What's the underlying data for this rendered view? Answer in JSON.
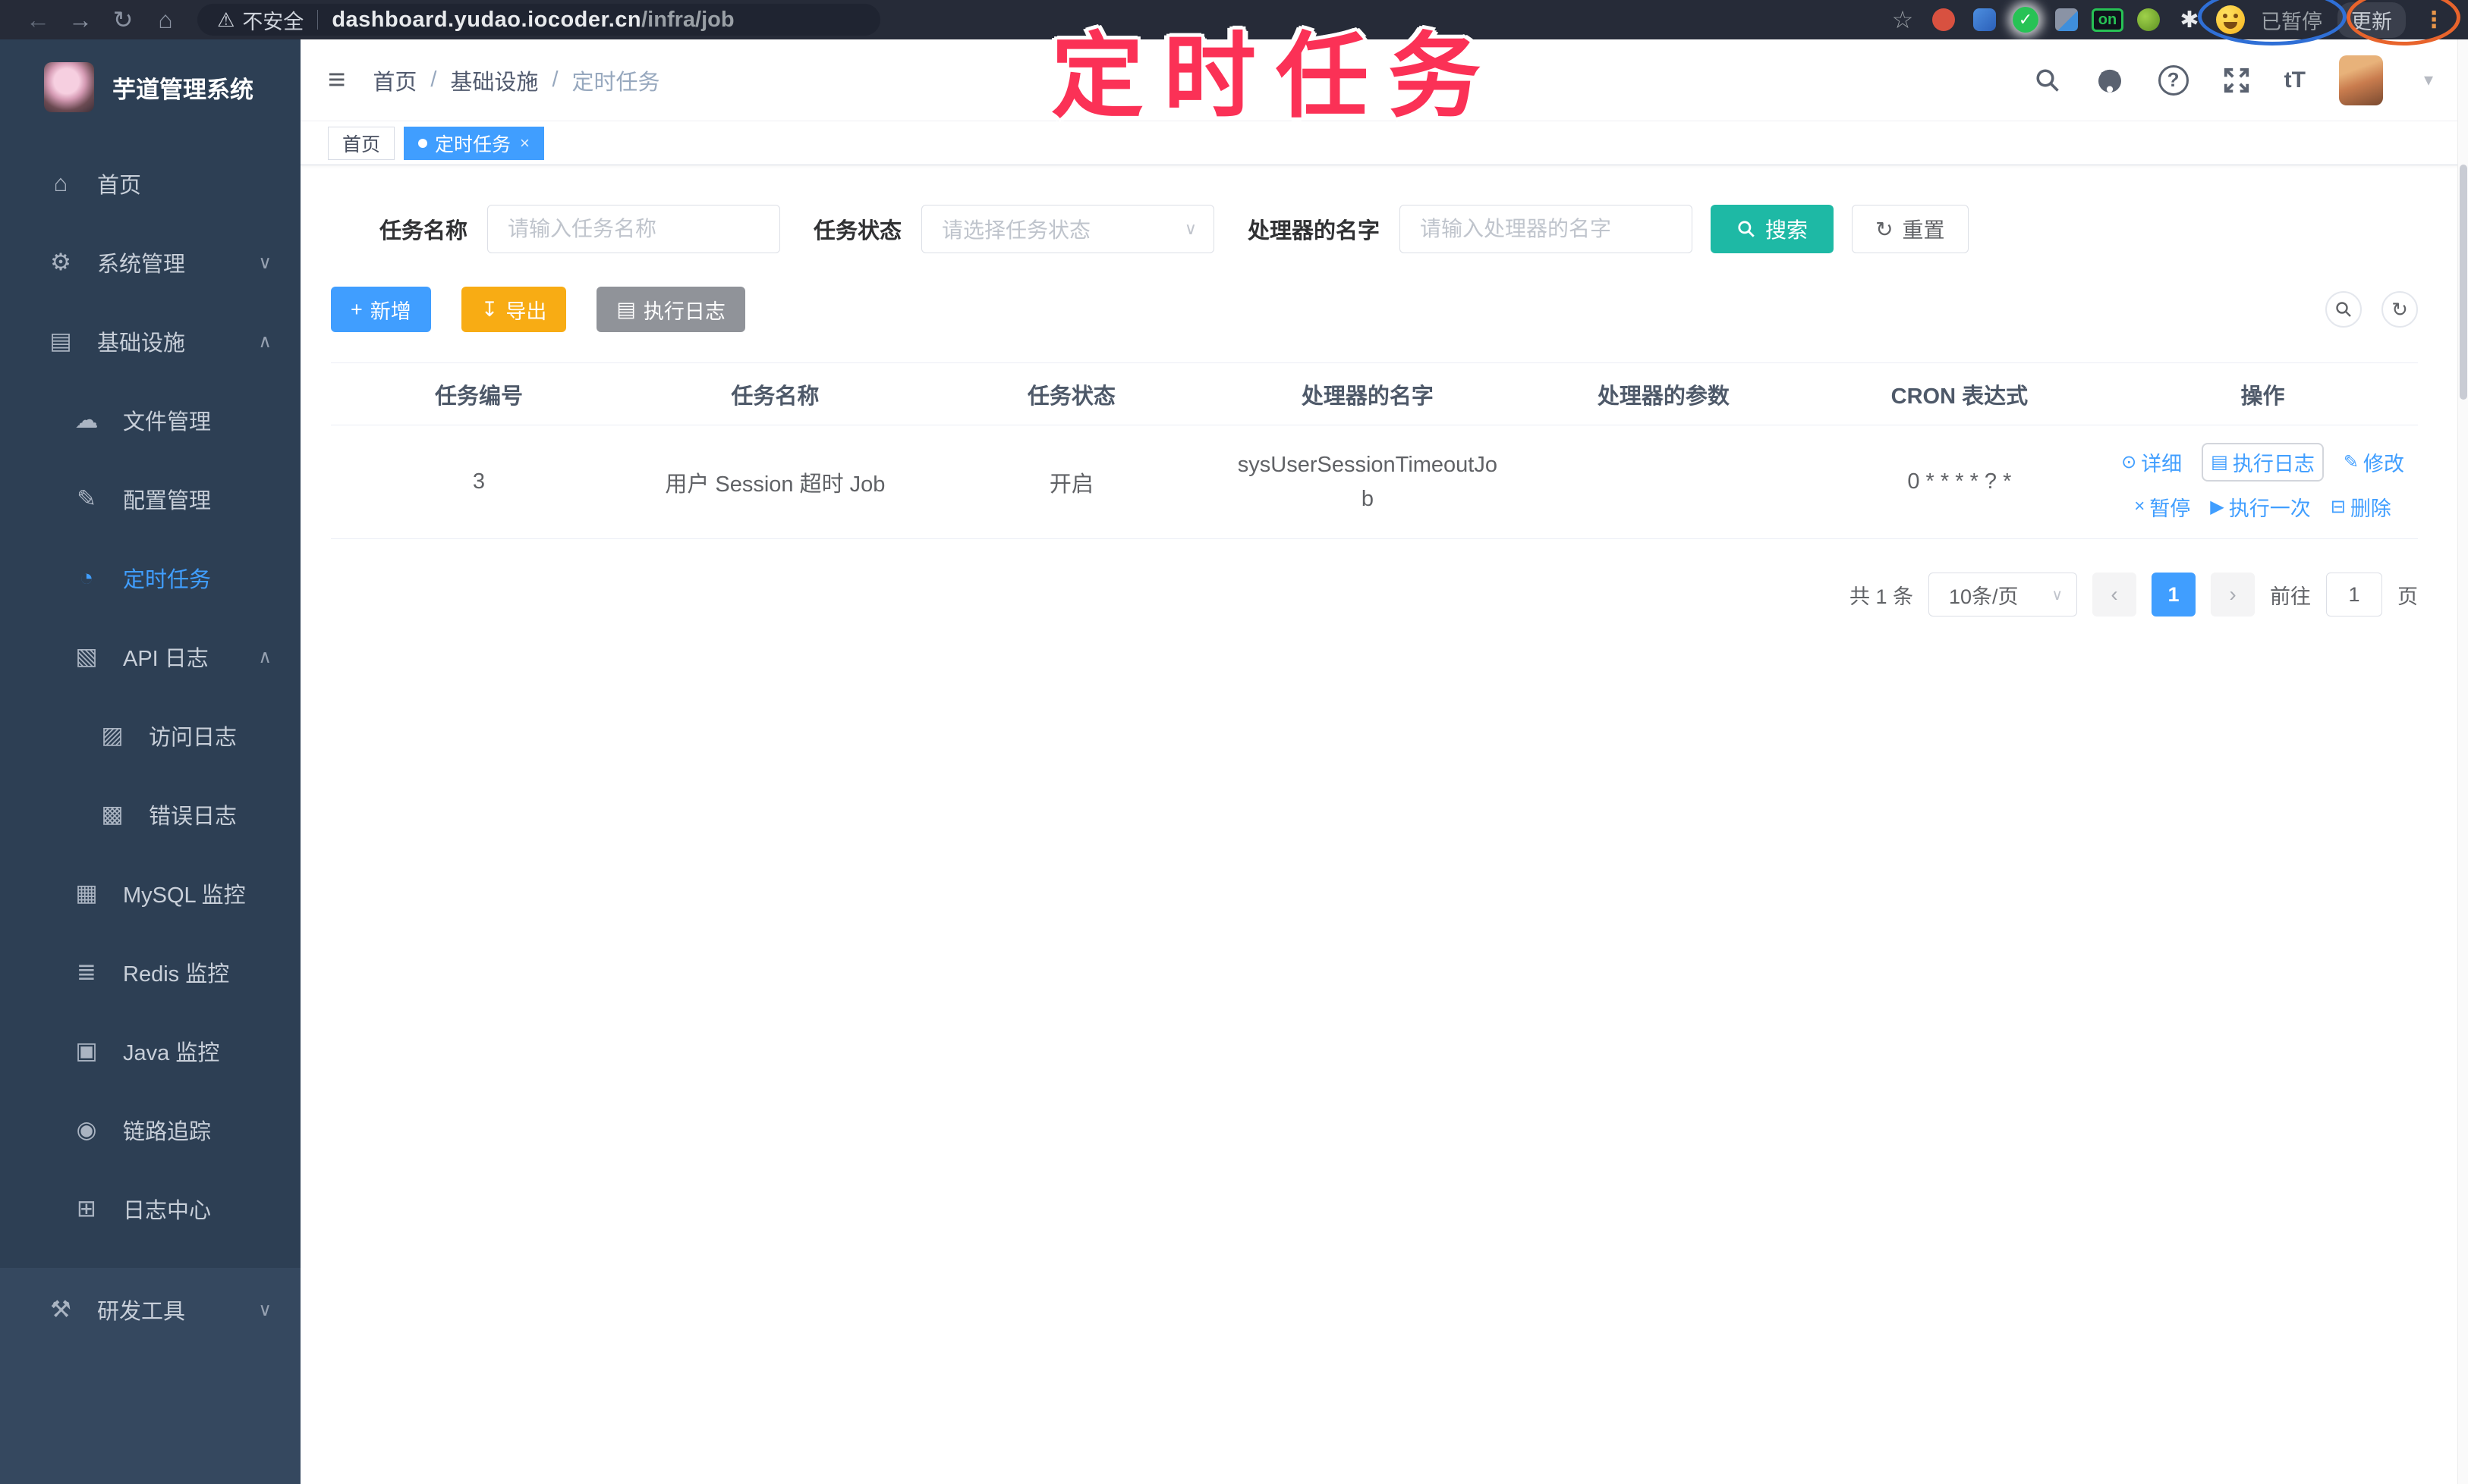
{
  "browser": {
    "security_label": "不安全",
    "url_domain": "dashboard.yudao.iocoder.cn",
    "url_path": "/infra/job",
    "paused_label": "已暂停",
    "update_label": "更新",
    "kebab_glyph": "⋮",
    "back_glyph": "←",
    "forward_glyph": "→",
    "reload_glyph": "↻",
    "home_glyph": "⌂",
    "warning_glyph": "⚠",
    "star_glyph": "☆",
    "puzzle_glyph": "✱",
    "check_glyph": "✓",
    "on_label": "on"
  },
  "annotation": {
    "title": "定时任务",
    "title_color": "#fb3156",
    "ellipse_blue_color": "#2f6fd6",
    "ellipse_orange_color": "#e8642c"
  },
  "sidebar": {
    "app_title": "芋道管理系统",
    "items": [
      {
        "label": "首页",
        "icon_glyph": "⌂"
      },
      {
        "label": "系统管理",
        "icon_glyph": "⚙",
        "chevron": "∨"
      },
      {
        "label": "基础设施",
        "icon_glyph": "▤",
        "chevron": "∧"
      },
      {
        "label": "文件管理",
        "icon_glyph": "☁"
      },
      {
        "label": "配置管理",
        "icon_glyph": "✎"
      },
      {
        "label": "定时任务",
        "icon_glyph": "◔"
      },
      {
        "label": "API 日志",
        "icon_glyph": "▧",
        "chevron": "∧"
      },
      {
        "label": "访问日志",
        "icon_glyph": "▨"
      },
      {
        "label": "错误日志",
        "icon_glyph": "▩"
      },
      {
        "label": "MySQL 监控",
        "icon_glyph": "▦"
      },
      {
        "label": "Redis 监控",
        "icon_glyph": "≣"
      },
      {
        "label": "Java 监控",
        "icon_glyph": "▣"
      },
      {
        "label": "链路追踪",
        "icon_glyph": "◉"
      },
      {
        "label": "日志中心",
        "icon_glyph": "⊞"
      },
      {
        "label": "研发工具",
        "icon_glyph": "⚒",
        "chevron": "∨"
      }
    ]
  },
  "header": {
    "hamburger_glyph": "≡",
    "breadcrumb": [
      "首页",
      "基础设施",
      "定时任务"
    ],
    "separator": "/",
    "help_glyph": "?",
    "fontsize_glyph": "tT",
    "caret_glyph": "▾"
  },
  "tabs": [
    {
      "label": "首页"
    },
    {
      "label": "定时任务",
      "close_glyph": "×"
    }
  ],
  "filters": {
    "name_label": "任务名称",
    "name_placeholder": "请输入任务名称",
    "status_label": "任务状态",
    "status_placeholder": "请选择任务状态",
    "handler_label": "处理器的名字",
    "handler_placeholder": "请输入处理器的名字",
    "search_label": "搜索",
    "reset_label": "重置",
    "reset_icon_glyph": "↻",
    "select_caret_glyph": "∨"
  },
  "toolbar": {
    "add_label": "新增",
    "add_icon_glyph": "+",
    "export_label": "导出",
    "export_icon_glyph": "↧",
    "joblog_label": "执行日志",
    "joblog_icon_glyph": "▤",
    "refresh_icon_glyph": "↻"
  },
  "table": {
    "columns": [
      "任务编号",
      "任务名称",
      "任务状态",
      "处理器的名字",
      "处理器的参数",
      "CRON 表达式",
      "操作"
    ],
    "row": {
      "id": "3",
      "name": "用户 Session 超时 Job",
      "status": "开启",
      "handler": "sysUserSessionTimeoutJob",
      "param": "",
      "cron": "0 * * * * ? *"
    },
    "actions": {
      "detail": "详细",
      "detail_icon": "⊙",
      "run_log": "执行日志",
      "run_log_icon": "▤",
      "edit": "修改",
      "edit_icon": "✎",
      "pause": "暂停",
      "pause_icon": "×",
      "run_once": "执行一次",
      "run_once_icon": "▶",
      "delete": "删除",
      "delete_icon": "⊟"
    }
  },
  "pagination": {
    "total_text": "共 1 条",
    "page_size_text": "10条/页",
    "prev_glyph": "‹",
    "page": "1",
    "next_glyph": "›",
    "goto_label": "前往",
    "goto_value": "1",
    "page_unit": "页"
  },
  "colors": {
    "primary": "#409EFF",
    "teal": "#1EB9A5",
    "amber": "#F8AC14",
    "info_gray": "#909399",
    "sidebar_bg": "#2d3f54",
    "chrome_bg": "#262b38"
  }
}
